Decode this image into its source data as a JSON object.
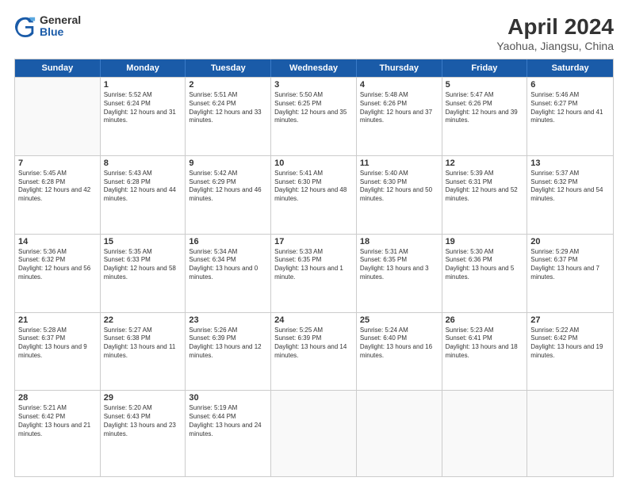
{
  "logo": {
    "general": "General",
    "blue": "Blue"
  },
  "title": "April 2024",
  "subtitle": "Yaohua, Jiangsu, China",
  "header_days": [
    "Sunday",
    "Monday",
    "Tuesday",
    "Wednesday",
    "Thursday",
    "Friday",
    "Saturday"
  ],
  "rows": [
    [
      {
        "day": "",
        "empty": true
      },
      {
        "day": "1",
        "sunrise": "Sunrise: 5:52 AM",
        "sunset": "Sunset: 6:24 PM",
        "daylight": "Daylight: 12 hours and 31 minutes."
      },
      {
        "day": "2",
        "sunrise": "Sunrise: 5:51 AM",
        "sunset": "Sunset: 6:24 PM",
        "daylight": "Daylight: 12 hours and 33 minutes."
      },
      {
        "day": "3",
        "sunrise": "Sunrise: 5:50 AM",
        "sunset": "Sunset: 6:25 PM",
        "daylight": "Daylight: 12 hours and 35 minutes."
      },
      {
        "day": "4",
        "sunrise": "Sunrise: 5:48 AM",
        "sunset": "Sunset: 6:26 PM",
        "daylight": "Daylight: 12 hours and 37 minutes."
      },
      {
        "day": "5",
        "sunrise": "Sunrise: 5:47 AM",
        "sunset": "Sunset: 6:26 PM",
        "daylight": "Daylight: 12 hours and 39 minutes."
      },
      {
        "day": "6",
        "sunrise": "Sunrise: 5:46 AM",
        "sunset": "Sunset: 6:27 PM",
        "daylight": "Daylight: 12 hours and 41 minutes."
      }
    ],
    [
      {
        "day": "7",
        "sunrise": "Sunrise: 5:45 AM",
        "sunset": "Sunset: 6:28 PM",
        "daylight": "Daylight: 12 hours and 42 minutes."
      },
      {
        "day": "8",
        "sunrise": "Sunrise: 5:43 AM",
        "sunset": "Sunset: 6:28 PM",
        "daylight": "Daylight: 12 hours and 44 minutes."
      },
      {
        "day": "9",
        "sunrise": "Sunrise: 5:42 AM",
        "sunset": "Sunset: 6:29 PM",
        "daylight": "Daylight: 12 hours and 46 minutes."
      },
      {
        "day": "10",
        "sunrise": "Sunrise: 5:41 AM",
        "sunset": "Sunset: 6:30 PM",
        "daylight": "Daylight: 12 hours and 48 minutes."
      },
      {
        "day": "11",
        "sunrise": "Sunrise: 5:40 AM",
        "sunset": "Sunset: 6:30 PM",
        "daylight": "Daylight: 12 hours and 50 minutes."
      },
      {
        "day": "12",
        "sunrise": "Sunrise: 5:39 AM",
        "sunset": "Sunset: 6:31 PM",
        "daylight": "Daylight: 12 hours and 52 minutes."
      },
      {
        "day": "13",
        "sunrise": "Sunrise: 5:37 AM",
        "sunset": "Sunset: 6:32 PM",
        "daylight": "Daylight: 12 hours and 54 minutes."
      }
    ],
    [
      {
        "day": "14",
        "sunrise": "Sunrise: 5:36 AM",
        "sunset": "Sunset: 6:32 PM",
        "daylight": "Daylight: 12 hours and 56 minutes."
      },
      {
        "day": "15",
        "sunrise": "Sunrise: 5:35 AM",
        "sunset": "Sunset: 6:33 PM",
        "daylight": "Daylight: 12 hours and 58 minutes."
      },
      {
        "day": "16",
        "sunrise": "Sunrise: 5:34 AM",
        "sunset": "Sunset: 6:34 PM",
        "daylight": "Daylight: 13 hours and 0 minutes."
      },
      {
        "day": "17",
        "sunrise": "Sunrise: 5:33 AM",
        "sunset": "Sunset: 6:35 PM",
        "daylight": "Daylight: 13 hours and 1 minute."
      },
      {
        "day": "18",
        "sunrise": "Sunrise: 5:31 AM",
        "sunset": "Sunset: 6:35 PM",
        "daylight": "Daylight: 13 hours and 3 minutes."
      },
      {
        "day": "19",
        "sunrise": "Sunrise: 5:30 AM",
        "sunset": "Sunset: 6:36 PM",
        "daylight": "Daylight: 13 hours and 5 minutes."
      },
      {
        "day": "20",
        "sunrise": "Sunrise: 5:29 AM",
        "sunset": "Sunset: 6:37 PM",
        "daylight": "Daylight: 13 hours and 7 minutes."
      }
    ],
    [
      {
        "day": "21",
        "sunrise": "Sunrise: 5:28 AM",
        "sunset": "Sunset: 6:37 PM",
        "daylight": "Daylight: 13 hours and 9 minutes."
      },
      {
        "day": "22",
        "sunrise": "Sunrise: 5:27 AM",
        "sunset": "Sunset: 6:38 PM",
        "daylight": "Daylight: 13 hours and 11 minutes."
      },
      {
        "day": "23",
        "sunrise": "Sunrise: 5:26 AM",
        "sunset": "Sunset: 6:39 PM",
        "daylight": "Daylight: 13 hours and 12 minutes."
      },
      {
        "day": "24",
        "sunrise": "Sunrise: 5:25 AM",
        "sunset": "Sunset: 6:39 PM",
        "daylight": "Daylight: 13 hours and 14 minutes."
      },
      {
        "day": "25",
        "sunrise": "Sunrise: 5:24 AM",
        "sunset": "Sunset: 6:40 PM",
        "daylight": "Daylight: 13 hours and 16 minutes."
      },
      {
        "day": "26",
        "sunrise": "Sunrise: 5:23 AM",
        "sunset": "Sunset: 6:41 PM",
        "daylight": "Daylight: 13 hours and 18 minutes."
      },
      {
        "day": "27",
        "sunrise": "Sunrise: 5:22 AM",
        "sunset": "Sunset: 6:42 PM",
        "daylight": "Daylight: 13 hours and 19 minutes."
      }
    ],
    [
      {
        "day": "28",
        "sunrise": "Sunrise: 5:21 AM",
        "sunset": "Sunset: 6:42 PM",
        "daylight": "Daylight: 13 hours and 21 minutes."
      },
      {
        "day": "29",
        "sunrise": "Sunrise: 5:20 AM",
        "sunset": "Sunset: 6:43 PM",
        "daylight": "Daylight: 13 hours and 23 minutes."
      },
      {
        "day": "30",
        "sunrise": "Sunrise: 5:19 AM",
        "sunset": "Sunset: 6:44 PM",
        "daylight": "Daylight: 13 hours and 24 minutes."
      },
      {
        "day": "",
        "empty": true
      },
      {
        "day": "",
        "empty": true
      },
      {
        "day": "",
        "empty": true
      },
      {
        "day": "",
        "empty": true
      }
    ]
  ]
}
